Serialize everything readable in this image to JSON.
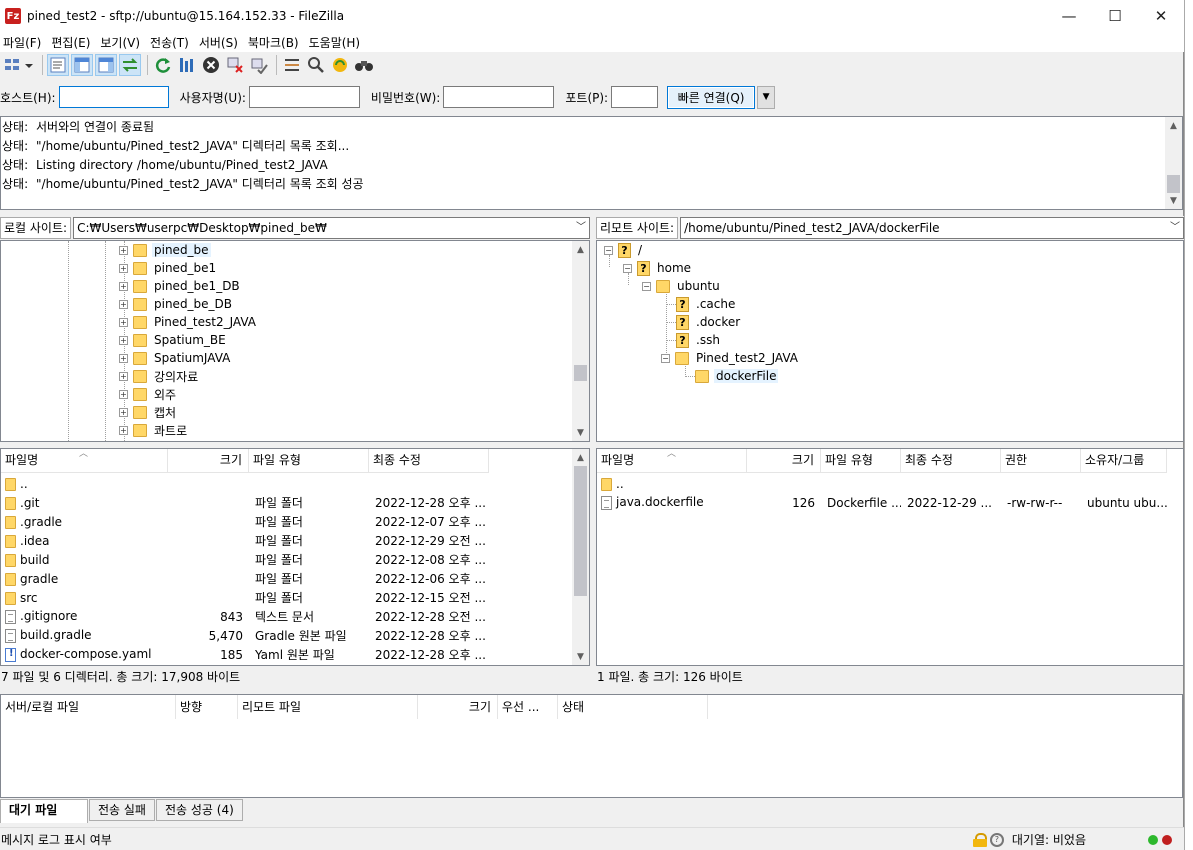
{
  "window": {
    "title": "pined_test2 - sftp://ubuntu@15.164.152.33 - FileZilla",
    "app_icon": "Fz",
    "minimize": "—",
    "maximize": "☐",
    "close": "✕"
  },
  "menu": [
    "파일(F)",
    "편집(E)",
    "보기(V)",
    "전송(T)",
    "서버(S)",
    "북마크(B)",
    "도움말(H)"
  ],
  "quickconnect": {
    "host_label": "호스트(H):",
    "host_value": "",
    "user_label": "사용자명(U):",
    "user_value": "",
    "pass_label": "비밀번호(W):",
    "pass_value": "",
    "port_label": "포트(P):",
    "port_value": "",
    "connect_button": "빠른 연결(Q)",
    "dropdown": "▼"
  },
  "log": [
    {
      "key": "상태:",
      "text": "서버와의 연결이 종료됨"
    },
    {
      "key": "상태:",
      "text": "\"/home/ubuntu/Pined_test2_JAVA\" 디렉터리 목록 조회..."
    },
    {
      "key": "상태:",
      "text": "Listing directory /home/ubuntu/Pined_test2_JAVA"
    },
    {
      "key": "상태:",
      "text": "\"/home/ubuntu/Pined_test2_JAVA\" 디렉터리 목록 조회 성공"
    }
  ],
  "local_site": {
    "label": "로컬 사이트:",
    "path": "C:₩Users₩userpc₩Desktop₩pined_be₩",
    "tree": [
      "pined_be",
      "pined_be1",
      "pined_be1_DB",
      "pined_be_DB",
      "Pined_test2_JAVA",
      "Spatium_BE",
      "SpatiumJAVA",
      "강의자료",
      "외주",
      "캡처",
      "콰트로"
    ]
  },
  "remote_site": {
    "label": "리모트 사이트:",
    "path": "/home/ubuntu/Pined_test2_JAVA/dockerFile",
    "tree": {
      "root": "/",
      "home": "home",
      "ubuntu": "ubuntu",
      "cache": ".cache",
      "docker": ".docker",
      "ssh": ".ssh",
      "project": "Pined_test2_JAVA",
      "current": "dockerFile"
    }
  },
  "local_files": {
    "headers": {
      "name": "파일명",
      "size": "크기",
      "type": "파일 유형",
      "modified": "최종 수정"
    },
    "rows": [
      {
        "name": "..",
        "size": "",
        "type": "",
        "modified": "",
        "icon": "folder"
      },
      {
        "name": ".git",
        "size": "",
        "type": "파일 폴더",
        "modified": "2022-12-28 오후 ...",
        "icon": "folder"
      },
      {
        "name": ".gradle",
        "size": "",
        "type": "파일 폴더",
        "modified": "2022-12-07 오후 ...",
        "icon": "folder"
      },
      {
        "name": ".idea",
        "size": "",
        "type": "파일 폴더",
        "modified": "2022-12-29 오전 ...",
        "icon": "folder"
      },
      {
        "name": "build",
        "size": "",
        "type": "파일 폴더",
        "modified": "2022-12-08 오후 ...",
        "icon": "folder"
      },
      {
        "name": "gradle",
        "size": "",
        "type": "파일 폴더",
        "modified": "2022-12-06 오후 ...",
        "icon": "folder"
      },
      {
        "name": "src",
        "size": "",
        "type": "파일 폴더",
        "modified": "2022-12-15 오전 ...",
        "icon": "folder"
      },
      {
        "name": ".gitignore",
        "size": "843",
        "type": "텍스트 문서",
        "modified": "2022-12-28 오전 ...",
        "icon": "txt"
      },
      {
        "name": "build.gradle",
        "size": "5,470",
        "type": "Gradle 원본 파일",
        "modified": "2022-12-28 오후 ...",
        "icon": "txt"
      },
      {
        "name": "docker-compose.yaml",
        "size": "185",
        "type": "Yaml 원본 파일",
        "modified": "2022-12-28 오후 ...",
        "icon": "yaml"
      }
    ],
    "status": "7 파일 및 6 디렉터리. 총 크기: 17,908 바이트"
  },
  "remote_files": {
    "headers": {
      "name": "파일명",
      "size": "크기",
      "type": "파일 유형",
      "modified": "최종 수정",
      "perm": "권한",
      "owner": "소유자/그룹"
    },
    "rows": [
      {
        "name": "..",
        "size": "",
        "type": "",
        "modified": "",
        "perm": "",
        "owner": "",
        "icon": "folder"
      },
      {
        "name": "java.dockerfile",
        "size": "126",
        "type": "Dockerfile ...",
        "modified": "2022-12-29 ...",
        "perm": "-rw-rw-r--",
        "owner": "ubuntu ubu...",
        "icon": "txt"
      }
    ],
    "status": "1 파일. 총 크기: 126 바이트"
  },
  "queue": {
    "headers": {
      "local": "서버/로컬 파일",
      "dir": "방향",
      "remote": "리모트 파일",
      "size": "크기",
      "prio": "우선 ...",
      "status": "상태"
    }
  },
  "tabs": [
    "대기 파일",
    "전송 실패",
    "전송 성공 (4)"
  ],
  "bottom": {
    "left": "메시지 로그 표시 여부",
    "queue": "대기열: 비었음"
  },
  "colors": {
    "led_green": "#2db82d",
    "led_red": "#c01f1f",
    "accent": "#0078d7"
  }
}
